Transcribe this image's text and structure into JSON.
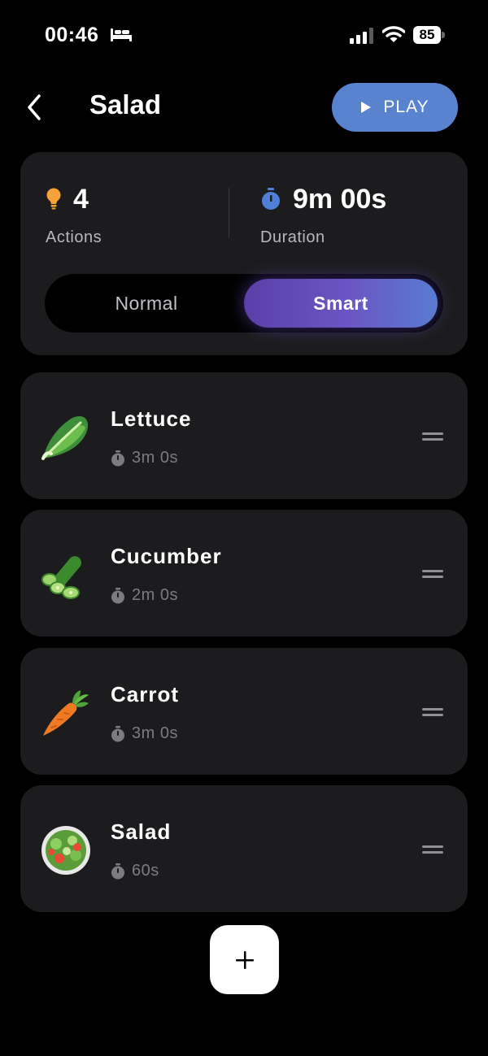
{
  "status_bar": {
    "time": "00:46",
    "battery": "85",
    "icons": [
      "bed-icon",
      "signal-icon",
      "wifi-icon",
      "battery-icon"
    ]
  },
  "header": {
    "title": "Salad",
    "play_label": "PLAY",
    "icons": [
      "back-icon",
      "play-icon"
    ],
    "accent_color": "#5a83cf"
  },
  "summary": {
    "actions": {
      "value": "4",
      "label": "Actions",
      "icon": "lightbulb-icon",
      "icon_color": "#f4a338"
    },
    "duration": {
      "value": "9m 00s",
      "label": "Duration",
      "icon": "stopwatch-icon",
      "icon_color": "#4f7fd6"
    },
    "modes": {
      "options": [
        "Normal",
        "Smart"
      ],
      "selected": "Smart"
    }
  },
  "actions": [
    {
      "name": "Lettuce",
      "duration": "3m 0s",
      "icon": "lettuce-icon"
    },
    {
      "name": "Cucumber",
      "duration": "2m 0s",
      "icon": "cucumber-icon"
    },
    {
      "name": "Carrot",
      "duration": "3m 0s",
      "icon": "carrot-icon"
    },
    {
      "name": "Salad",
      "duration": "60s",
      "icon": "salad-bowl-icon"
    }
  ],
  "footer": {
    "add_icon": "plus-icon"
  }
}
